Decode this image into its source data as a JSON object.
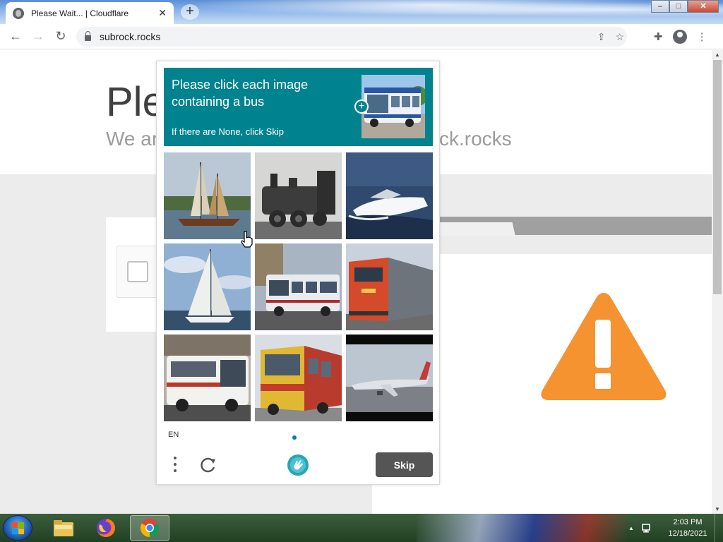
{
  "browser": {
    "tab_title": "Please Wait... | Cloudflare",
    "tab_close": "✕",
    "new_tab": "+",
    "url": "subrock.rocks",
    "window_controls": {
      "minimize": "–",
      "maximize": "□",
      "close": "✕"
    }
  },
  "page": {
    "title_partial": "Ple",
    "subtitle_partial_left": "We ar",
    "subtitle_partial_right": "ck.rocks",
    "warning_color": "#f59331"
  },
  "captcha": {
    "prompt": "Please click each image containing a bus",
    "sub": "If there are None, click Skip",
    "accent": "#00838f",
    "tiles": [
      {
        "subject": "sailboat"
      },
      {
        "subject": "steam-locomotive"
      },
      {
        "subject": "speedboat"
      },
      {
        "subject": "sailboat"
      },
      {
        "subject": "bus"
      },
      {
        "subject": "train"
      },
      {
        "subject": "bus"
      },
      {
        "subject": "bus"
      },
      {
        "subject": "airplane"
      }
    ],
    "language": "EN",
    "skip_label": "Skip"
  },
  "taskbar": {
    "apps": [
      "file-explorer",
      "firefox",
      "chrome"
    ],
    "active_app": "chrome",
    "time": "2:03 PM",
    "date": "12/18/2021"
  }
}
